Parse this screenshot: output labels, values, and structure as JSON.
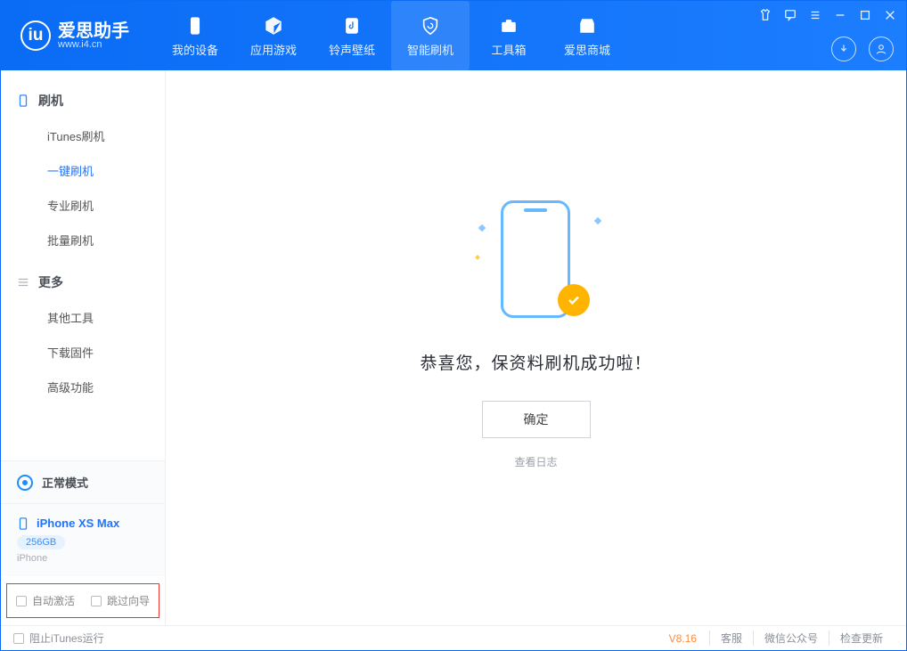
{
  "app": {
    "name_cn": "爱思助手",
    "domain": "www.i4.cn",
    "logo_letter": "iu"
  },
  "nav": {
    "my_device": "我的设备",
    "apps_games": "应用游戏",
    "ring_wall": "铃声壁纸",
    "smart_flash": "智能刷机",
    "toolbox": "工具箱",
    "store": "爱思商城"
  },
  "sidebar": {
    "flash_header": "刷机",
    "itunes_flash": "iTunes刷机",
    "onekey_flash": "一键刷机",
    "pro_flash": "专业刷机",
    "batch_flash": "批量刷机",
    "more_header": "更多",
    "other_tools": "其他工具",
    "download_fw": "下载固件",
    "advanced": "高级功能"
  },
  "mode": {
    "label": "正常模式"
  },
  "device": {
    "name": "iPhone XS Max",
    "storage": "256GB",
    "type": "iPhone"
  },
  "checks": {
    "auto_activate": "自动激活",
    "skip_wizard": "跳过向导"
  },
  "main": {
    "success": "恭喜您，保资料刷机成功啦！",
    "ok": "确定",
    "view_log": "查看日志"
  },
  "footer": {
    "block_itunes": "阻止iTunes运行",
    "version": "V8.16",
    "support": "客服",
    "wechat": "微信公众号",
    "check_update": "检查更新"
  }
}
